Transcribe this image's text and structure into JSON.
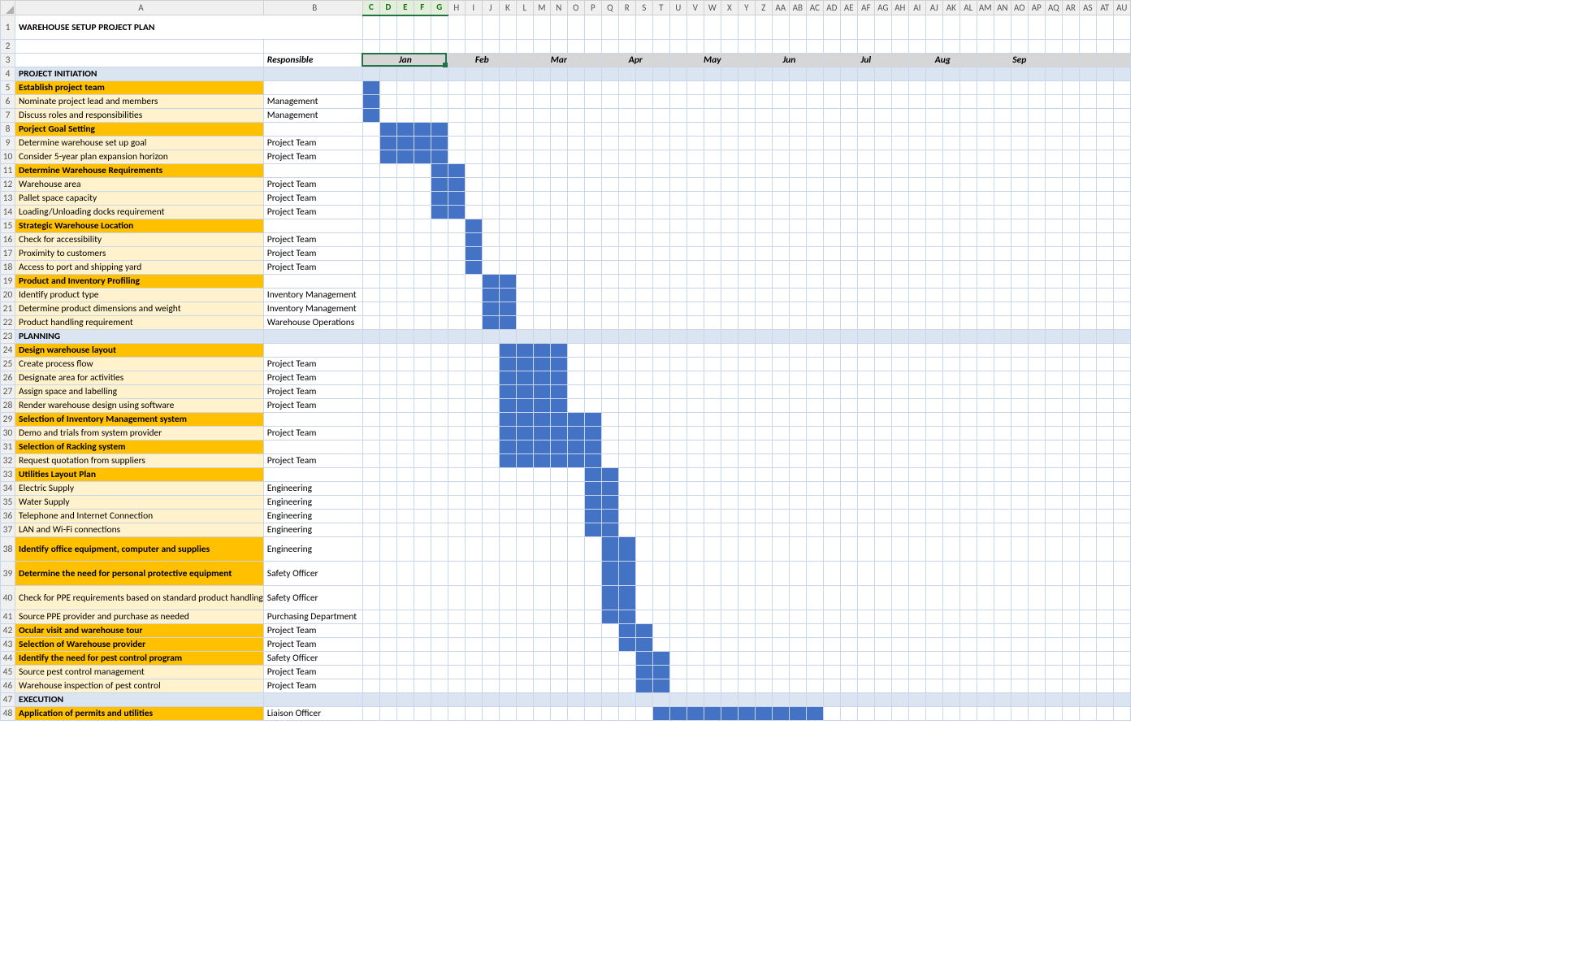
{
  "title": "WAREHOUSE SETUP PROJECT PLAN",
  "responsible_header": "Responsible",
  "months": [
    "Jan",
    "Feb",
    "Mar",
    "Apr",
    "May",
    "Jun",
    "Jul",
    "Aug",
    "Sep"
  ],
  "month_spans": [
    5,
    4,
    5,
    4,
    5,
    4,
    5,
    4,
    5
  ],
  "gantt_columns": 45,
  "col_letters": [
    "C",
    "D",
    "E",
    "F",
    "G",
    "H",
    "I",
    "J",
    "K",
    "L",
    "M",
    "N",
    "O",
    "P",
    "Q",
    "R",
    "S",
    "T",
    "U",
    "V",
    "W",
    "X",
    "Y",
    "Z",
    "AA",
    "AB",
    "AC",
    "AD",
    "AE",
    "AF",
    "AG",
    "AH",
    "AI",
    "AJ",
    "AK",
    "AL",
    "AM",
    "AN",
    "AO",
    "AP",
    "AQ",
    "AR",
    "AS",
    "AT",
    "AU"
  ],
  "selected_cols": [
    "C",
    "D",
    "E",
    "F",
    "G"
  ],
  "chart_data": {
    "type": "gantt",
    "x_unit": "week-column (index 0-44)",
    "rows_reference": "see rows[] array"
  },
  "rows": [
    {
      "n": 4,
      "type": "phase",
      "a": "PROJECT INITIATION"
    },
    {
      "n": 5,
      "type": "group",
      "a": "Establish project team",
      "bar": [
        0,
        0
      ]
    },
    {
      "n": 6,
      "type": "task",
      "a": "Nominate project lead and members",
      "b": "Management",
      "bar": [
        0,
        0
      ]
    },
    {
      "n": 7,
      "type": "task",
      "a": "Discuss roles and responsibilities",
      "b": "Management",
      "bar": [
        0,
        0
      ]
    },
    {
      "n": 8,
      "type": "group",
      "a": "Porject Goal Setting",
      "bar": [
        1,
        4
      ]
    },
    {
      "n": 9,
      "type": "task",
      "a": "Determine warehouse set up goal",
      "b": "Project Team",
      "bar": [
        1,
        4
      ]
    },
    {
      "n": 10,
      "type": "task",
      "a": "Consider 5-year plan expansion horizon",
      "b": "Project Team",
      "bar": [
        1,
        4
      ]
    },
    {
      "n": 11,
      "type": "group",
      "a": "Determine Warehouse Requirements",
      "bar": [
        4,
        5
      ]
    },
    {
      "n": 12,
      "type": "task",
      "a": "Warehouse area",
      "b": "Project Team",
      "bar": [
        4,
        5
      ]
    },
    {
      "n": 13,
      "type": "task",
      "a": "Pallet space capacity",
      "b": "Project Team",
      "bar": [
        4,
        5
      ]
    },
    {
      "n": 14,
      "type": "task",
      "a": "Loading/Unloading docks requirement",
      "b": "Project Team",
      "bar": [
        4,
        5
      ]
    },
    {
      "n": 15,
      "type": "group",
      "a": "Strategic Warehouse Location",
      "bar": [
        6,
        6
      ]
    },
    {
      "n": 16,
      "type": "task",
      "a": "Check for accessibility",
      "b": "Project Team",
      "bar": [
        6,
        6
      ]
    },
    {
      "n": 17,
      "type": "task",
      "a": "Proximity to customers",
      "b": "Project Team",
      "bar": [
        6,
        6
      ]
    },
    {
      "n": 18,
      "type": "task",
      "a": "Access to port and shipping yard",
      "b": "Project Team",
      "bar": [
        6,
        6
      ]
    },
    {
      "n": 19,
      "type": "group",
      "a": "Product and Inventory Profiling",
      "bar": [
        7,
        8
      ]
    },
    {
      "n": 20,
      "type": "task",
      "a": "Identify product type",
      "b": "Inventory Management",
      "bar": [
        7,
        8
      ]
    },
    {
      "n": 21,
      "type": "task",
      "a": "Determine product dimensions and weight",
      "b": "Inventory Management",
      "bar": [
        7,
        8
      ]
    },
    {
      "n": 22,
      "type": "task",
      "a": "Product handling requirement",
      "b": "Warehouse Operations",
      "bar": [
        7,
        8
      ]
    },
    {
      "n": 23,
      "type": "phase",
      "a": "PLANNING"
    },
    {
      "n": 24,
      "type": "group",
      "a": "Design warehouse layout",
      "bar": [
        8,
        11
      ]
    },
    {
      "n": 25,
      "type": "task",
      "a": "Create process flow",
      "b": "Project Team",
      "bar": [
        8,
        11
      ]
    },
    {
      "n": 26,
      "type": "task",
      "a": "Designate area for activities",
      "b": "Project Team",
      "bar": [
        8,
        11
      ]
    },
    {
      "n": 27,
      "type": "task",
      "a": "Assign space and labelling",
      "b": "Project Team",
      "bar": [
        8,
        11
      ]
    },
    {
      "n": 28,
      "type": "task",
      "a": "Render warehouse design using software",
      "b": "Project Team",
      "bar": [
        8,
        11
      ]
    },
    {
      "n": 29,
      "type": "group",
      "a": "Selection of Inventory Management system",
      "bar": [
        8,
        13
      ]
    },
    {
      "n": 30,
      "type": "task",
      "a": "Demo and trials from system provider",
      "b": "Project Team",
      "bar": [
        8,
        13
      ]
    },
    {
      "n": 31,
      "type": "group",
      "a": "Selection of Racking system",
      "bar": [
        8,
        13
      ]
    },
    {
      "n": 32,
      "type": "task",
      "a": "Request quotation from suppliers",
      "b": "Project Team",
      "bar": [
        8,
        13
      ]
    },
    {
      "n": 33,
      "type": "group",
      "a": "Utilities Layout Plan",
      "bar": [
        13,
        14
      ]
    },
    {
      "n": 34,
      "type": "task",
      "a": "Electric Supply",
      "b": "Engineering",
      "bar": [
        13,
        14
      ]
    },
    {
      "n": 35,
      "type": "task",
      "a": "Water Supply",
      "b": "Engineering",
      "bar": [
        13,
        14
      ]
    },
    {
      "n": 36,
      "type": "task",
      "a": "Telephone and Internet Connection",
      "b": "Engineering",
      "bar": [
        13,
        14
      ]
    },
    {
      "n": 37,
      "type": "task",
      "a": "LAN and Wi-Fi connections",
      "b": "Engineering",
      "bar": [
        13,
        14
      ]
    },
    {
      "n": 38,
      "type": "group",
      "a": "Identify office equipment, computer and supplies",
      "b": "Engineering",
      "bar": [
        14,
        15
      ],
      "tall": true
    },
    {
      "n": 39,
      "type": "group",
      "a": "Determine the need for personal protective equipment",
      "b": "Safety Officer",
      "bar": [
        14,
        15
      ],
      "tall": true
    },
    {
      "n": 40,
      "type": "task",
      "a": "Check for PPE requirements based on standard product handling",
      "b": "Safety Officer",
      "bar": [
        14,
        15
      ],
      "tall": true
    },
    {
      "n": 41,
      "type": "task",
      "a": "Source PPE provider and purchase as needed",
      "b": "Purchasing Department",
      "bar": [
        14,
        15
      ]
    },
    {
      "n": 42,
      "type": "group",
      "a": "Ocular visit and warehouse tour",
      "b": "Project Team",
      "bar": [
        15,
        16
      ]
    },
    {
      "n": 43,
      "type": "group",
      "a": "Selection of Warehouse provider",
      "b": "Project Team",
      "bar": [
        15,
        16
      ]
    },
    {
      "n": 44,
      "type": "group",
      "a": "Identify the need for pest control program",
      "b": "Safety Officer",
      "bar": [
        16,
        17
      ]
    },
    {
      "n": 45,
      "type": "task",
      "a": "Source pest control management",
      "b": "Project Team",
      "bar": [
        16,
        17
      ]
    },
    {
      "n": 46,
      "type": "task",
      "a": "Warehouse inspection of pest control",
      "b": "Project Team",
      "bar": [
        16,
        17
      ]
    },
    {
      "n": 47,
      "type": "phase",
      "a": "EXECUTION"
    },
    {
      "n": 48,
      "type": "group",
      "a": "Application of permits and utilities",
      "b": "Liaison Officer",
      "bar": [
        17,
        26
      ]
    }
  ]
}
